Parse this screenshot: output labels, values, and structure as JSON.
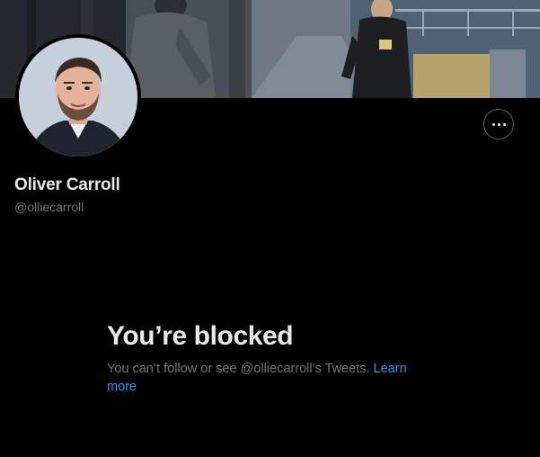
{
  "profile": {
    "display_name": "Oliver Carroll",
    "handle": "@olliecarroll"
  },
  "banner": {
    "description": "banner photo"
  },
  "avatar": {
    "icon": "profile-photo"
  },
  "more_button": {
    "icon": "more-icon"
  },
  "blocked": {
    "title": "You’re blocked",
    "message": "You can’t follow or see @olliecarroll’s Tweets.",
    "link_label": "Learn more"
  },
  "colors": {
    "background": "#000000",
    "primary_text": "#e7e9ea",
    "secondary_text": "#71767b",
    "link": "#1d9bf0",
    "border": "#536471"
  }
}
